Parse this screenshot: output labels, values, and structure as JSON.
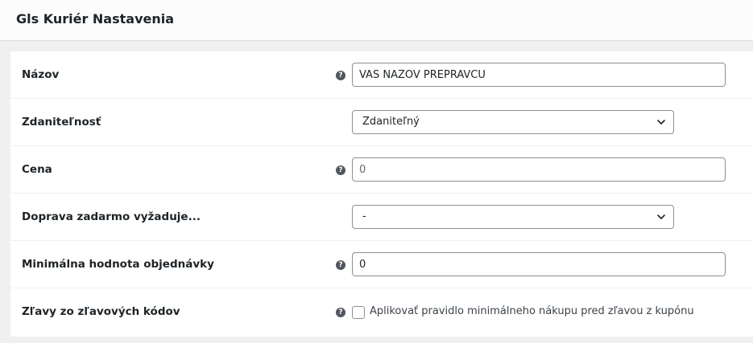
{
  "header": {
    "title": "Gls Kuriér Nastavenia"
  },
  "form": {
    "title_field": {
      "label": "Názov",
      "value": "VAS NAZOV PREPRAVCU",
      "help_icon": "question-circle-icon"
    },
    "tax_status": {
      "label": "Zdaniteľnosť",
      "selected": "Zdaniteľný",
      "icon": "chevron-down-icon"
    },
    "cost": {
      "label": "Cena",
      "placeholder": "0",
      "help_icon": "question-circle-icon"
    },
    "free_shipping_requires": {
      "label": "Doprava zadarmo vyžaduje...",
      "selected": "-",
      "icon": "chevron-down-icon"
    },
    "min_order_amount": {
      "label": "Minimálna hodnota objednávky",
      "value": "0",
      "help_icon": "question-circle-icon"
    },
    "coupon_discounts": {
      "label": "Zľavy zo zľavových kódov",
      "checkbox_label": "Aplikovať pravidlo minimálneho nákupu pred zľavou z kupónu",
      "checked": false,
      "help_icon": "question-circle-icon"
    }
  },
  "colors": {
    "background": "#f0f0f1",
    "card": "#ffffff",
    "border": "#8c8f94",
    "text": "#1d2327",
    "help_icon": "#50575e"
  }
}
